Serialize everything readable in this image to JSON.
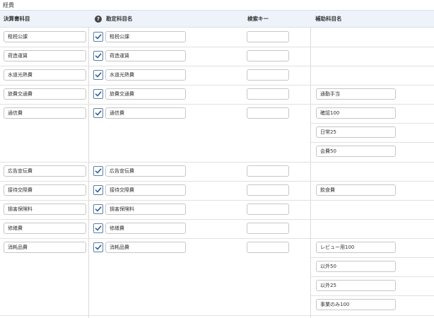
{
  "section_title": "経費",
  "headers": {
    "kessan": "決算書科目",
    "kanjo": "勘定科目名",
    "search": "検索キー",
    "hojo": "補助科目名"
  },
  "help_icon": "?",
  "rows": [
    {
      "kessan": "租税公課",
      "checked": true,
      "kanjo": "租税公課",
      "search": "",
      "hojo": []
    },
    {
      "kessan": "荷造運賃",
      "checked": true,
      "kanjo": "荷造運賃",
      "search": "",
      "hojo": []
    },
    {
      "kessan": "水道光熱費",
      "checked": true,
      "kanjo": "水道光熱費",
      "search": "",
      "hojo": []
    },
    {
      "kessan": "旅費交通費",
      "checked": true,
      "kanjo": "旅費交通費",
      "search": "",
      "hojo": [
        "通勤手当"
      ]
    },
    {
      "kessan": "通信費",
      "checked": true,
      "kanjo": "通信費",
      "search": "",
      "hojo": [
        "確認100",
        "日常25",
        "会費50"
      ]
    },
    {
      "kessan": "広告宣伝費",
      "checked": true,
      "kanjo": "広告宣伝費",
      "search": "",
      "hojo": []
    },
    {
      "kessan": "接待交際費",
      "checked": true,
      "kanjo": "接待交際費",
      "search": "",
      "hojo": [
        "飲食費"
      ]
    },
    {
      "kessan": "損害保険料",
      "checked": true,
      "kanjo": "損害保険料",
      "search": "",
      "hojo": []
    },
    {
      "kessan": "修繕費",
      "checked": true,
      "kanjo": "修繕費",
      "search": "",
      "hojo": []
    },
    {
      "kessan": "消耗品費",
      "checked": true,
      "kanjo": "消耗品費",
      "search": "",
      "hojo": [
        "レビュー用100",
        "以外50",
        "以外25",
        "事業のみ100"
      ]
    }
  ]
}
